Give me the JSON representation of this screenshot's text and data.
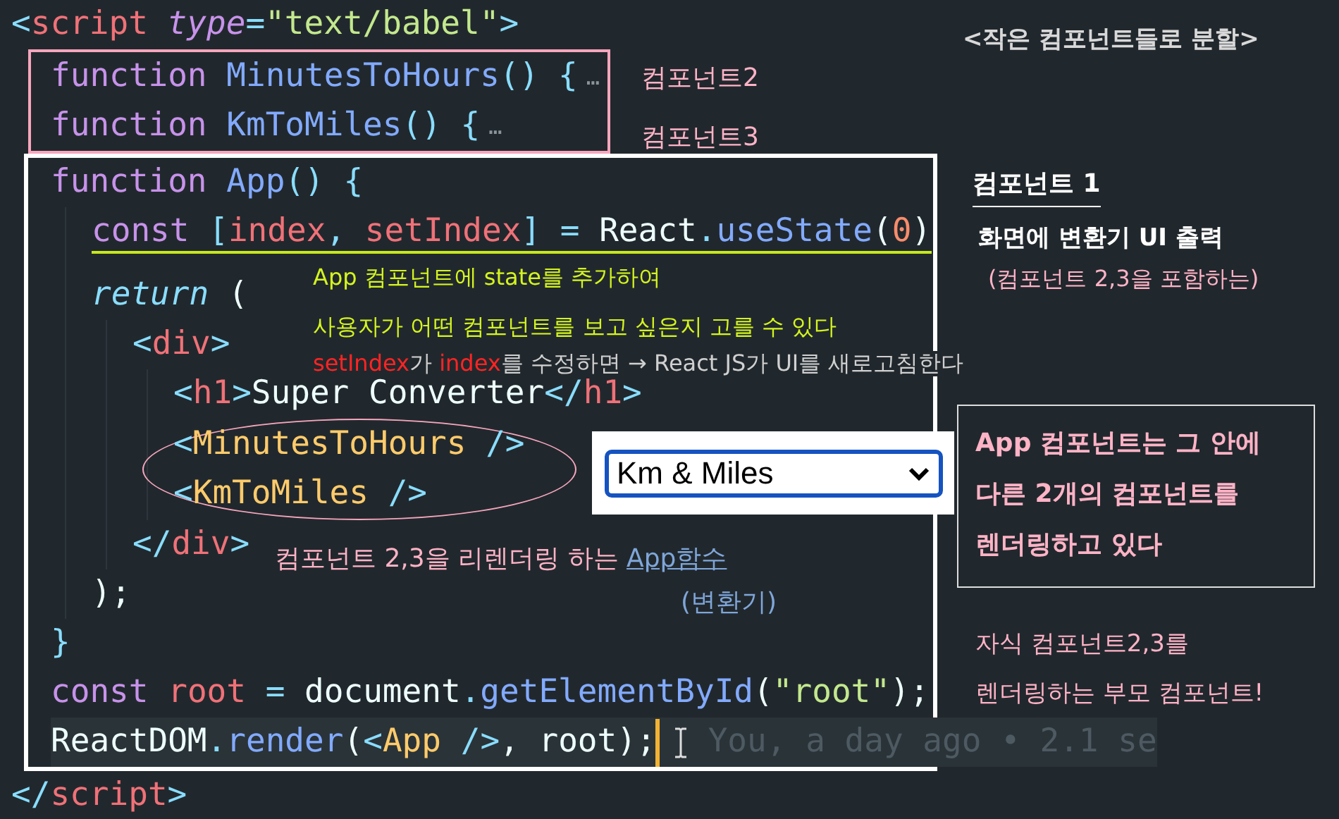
{
  "heading": "<작은 컴포넌트들로 분할>",
  "code": [
    {
      "kind": "line",
      "tokens": [
        {
          "kind": "punct",
          "text": "<"
        },
        {
          "kind": "tag",
          "text": "script"
        },
        {
          "kind": "attr",
          "text": " type"
        },
        {
          "kind": "punct",
          "text": "="
        },
        {
          "kind": "string",
          "text": "\"text/babel\""
        },
        {
          "kind": "punct",
          "text": ">"
        }
      ]
    },
    {
      "kind": "frame",
      "children": [
        {
          "kind": "line",
          "tokens": [
            {
              "kind": "keyword",
              "text": "function "
            },
            {
              "kind": "fn",
              "text": "MinutesToHours"
            },
            {
              "kind": "punct",
              "text": "() {"
            },
            {
              "kind": "fold",
              "text": "…"
            }
          ]
        },
        {
          "kind": "line",
          "tokens": [
            {
              "kind": "keyword",
              "text": "function "
            },
            {
              "kind": "fn",
              "text": "KmToMiles"
            },
            {
              "kind": "punct",
              "text": "() {"
            },
            {
              "kind": "fold",
              "text": "…"
            }
          ]
        }
      ]
    },
    {
      "kind": "frame",
      "children": [
        {
          "kind": "line",
          "tokens": [
            {
              "kind": "keyword",
              "text": "function "
            },
            {
              "kind": "fn",
              "text": "App"
            },
            {
              "kind": "punct",
              "text": "() {"
            }
          ],
          "children": [
            {
              "kind": "line",
              "underlined": true,
              "tokens": [
                {
                  "kind": "keyword",
                  "text": "const "
                },
                {
                  "kind": "punct",
                  "text": "["
                },
                {
                  "kind": "var",
                  "text": "index"
                },
                {
                  "kind": "punct",
                  "text": ", "
                },
                {
                  "kind": "var",
                  "text": "setIndex"
                },
                {
                  "kind": "punct",
                  "text": "] = "
                },
                {
                  "kind": "plain",
                  "text": "React"
                },
                {
                  "kind": "punct",
                  "text": "."
                },
                {
                  "kind": "fn",
                  "text": "useState"
                },
                {
                  "kind": "plain",
                  "text": "("
                },
                {
                  "kind": "number",
                  "text": "0"
                },
                {
                  "kind": "plain",
                  "text": ")"
                }
              ]
            },
            {
              "kind": "line",
              "tokens": [
                {
                  "kind": "control",
                  "text": "return"
                },
                {
                  "kind": "plain",
                  "text": " ("
                }
              ],
              "children": [
                {
                  "kind": "line",
                  "tokens": [
                    {
                      "kind": "punct",
                      "text": "<"
                    },
                    {
                      "kind": "tag",
                      "text": "div"
                    },
                    {
                      "kind": "punct",
                      "text": ">"
                    }
                  ],
                  "children": [
                    {
                      "kind": "line",
                      "tokens": [
                        {
                          "kind": "punct",
                          "text": "<"
                        },
                        {
                          "kind": "tag",
                          "text": "h1"
                        },
                        {
                          "kind": "punct",
                          "text": ">"
                        },
                        {
                          "kind": "plain",
                          "text": "Super Converter"
                        },
                        {
                          "kind": "punct",
                          "text": "</"
                        },
                        {
                          "kind": "tag",
                          "text": "h1"
                        },
                        {
                          "kind": "punct",
                          "text": ">"
                        }
                      ]
                    },
                    {
                      "kind": "circled",
                      "children": [
                        {
                          "kind": "line",
                          "tokens": [
                            {
                              "kind": "punct",
                              "text": "<"
                            },
                            {
                              "kind": "component",
                              "text": "MinutesToHours"
                            },
                            {
                              "kind": "punct",
                              "text": " />"
                            }
                          ]
                        },
                        {
                          "kind": "line",
                          "tokens": [
                            {
                              "kind": "punct",
                              "text": "<"
                            },
                            {
                              "kind": "component",
                              "text": "KmToMiles"
                            },
                            {
                              "kind": "punct",
                              "text": " />"
                            }
                          ]
                        }
                      ]
                    }
                  ]
                },
                {
                  "kind": "line",
                  "tokens": [
                    {
                      "kind": "punct",
                      "text": "</"
                    },
                    {
                      "kind": "tag",
                      "text": "div"
                    },
                    {
                      "kind": "punct",
                      "text": ">"
                    }
                  ]
                }
              ]
            },
            {
              "kind": "line",
              "tokens": [
                {
                  "kind": "plain",
                  "text": ");"
                }
              ]
            }
          ]
        },
        {
          "kind": "line",
          "tokens": [
            {
              "kind": "punct",
              "text": "}"
            }
          ]
        },
        {
          "kind": "line",
          "tokens": [
            {
              "kind": "keyword",
              "text": "const "
            },
            {
              "kind": "var",
              "text": "root"
            },
            {
              "kind": "punct",
              "text": " = "
            },
            {
              "kind": "plain",
              "text": "document"
            },
            {
              "kind": "punct",
              "text": "."
            },
            {
              "kind": "fn",
              "text": "getElementById"
            },
            {
              "kind": "plain",
              "text": "("
            },
            {
              "kind": "string",
              "text": "\"root\""
            },
            {
              "kind": "plain",
              "text": ");"
            }
          ]
        },
        {
          "kind": "line",
          "current": true,
          "tokens": [
            {
              "kind": "plain",
              "text": "ReactDOM"
            },
            {
              "kind": "punct",
              "text": "."
            },
            {
              "kind": "fn",
              "text": "render"
            },
            {
              "kind": "plain",
              "text": "("
            },
            {
              "kind": "punct",
              "text": "<"
            },
            {
              "kind": "component",
              "text": "App"
            },
            {
              "kind": "punct",
              "text": " />"
            },
            {
              "kind": "plain",
              "text": ", root);"
            },
            {
              "kind": "cursor"
            },
            {
              "kind": "blame",
              "text": "You, a day ago • 2.1 se"
            }
          ]
        }
      ]
    },
    {
      "kind": "line",
      "tokens": [
        {
          "kind": "punct",
          "text": "</"
        },
        {
          "kind": "tag",
          "text": "script"
        },
        {
          "kind": "punct",
          "text": ">"
        }
      ]
    }
  ],
  "component_labels": [
    "컴포넌트2",
    "컴포넌트3"
  ],
  "app_note": {
    "title": "컴포넌트 1",
    "subtitle": "화면에 변환기 UI 출력",
    "detail": "(컴포넌트 2,3을 포함하는)"
  },
  "state_note": [
    "App 컴포넌트에 state를 추가하여",
    "사용자가 어떤 컴포넌트를 보고 싶은지 고를 수 있다"
  ],
  "refresh_note": [
    {
      "kind": "code",
      "text": "setIndex"
    },
    {
      "kind": "plain",
      "text": "가 "
    },
    {
      "kind": "code",
      "text": "index"
    },
    {
      "kind": "plain",
      "text": "를 수정하면 → React JS가 UI를 새로고침한다"
    }
  ],
  "preview": {
    "select_value": "Km & Miles"
  },
  "render_note": {
    "text": "컴포넌트 2,3을 리렌더링 하는 ",
    "link": "App함수",
    "sub": "(변환기)"
  },
  "box_note": [
    "App 컴포넌트는 그 안에",
    "다른 2개의 컴포넌트를",
    "렌더링하고 있다"
  ],
  "parent_note": [
    "자식 컴포넌트2,3를",
    "렌더링하는 부모 컴포넌트!"
  ]
}
